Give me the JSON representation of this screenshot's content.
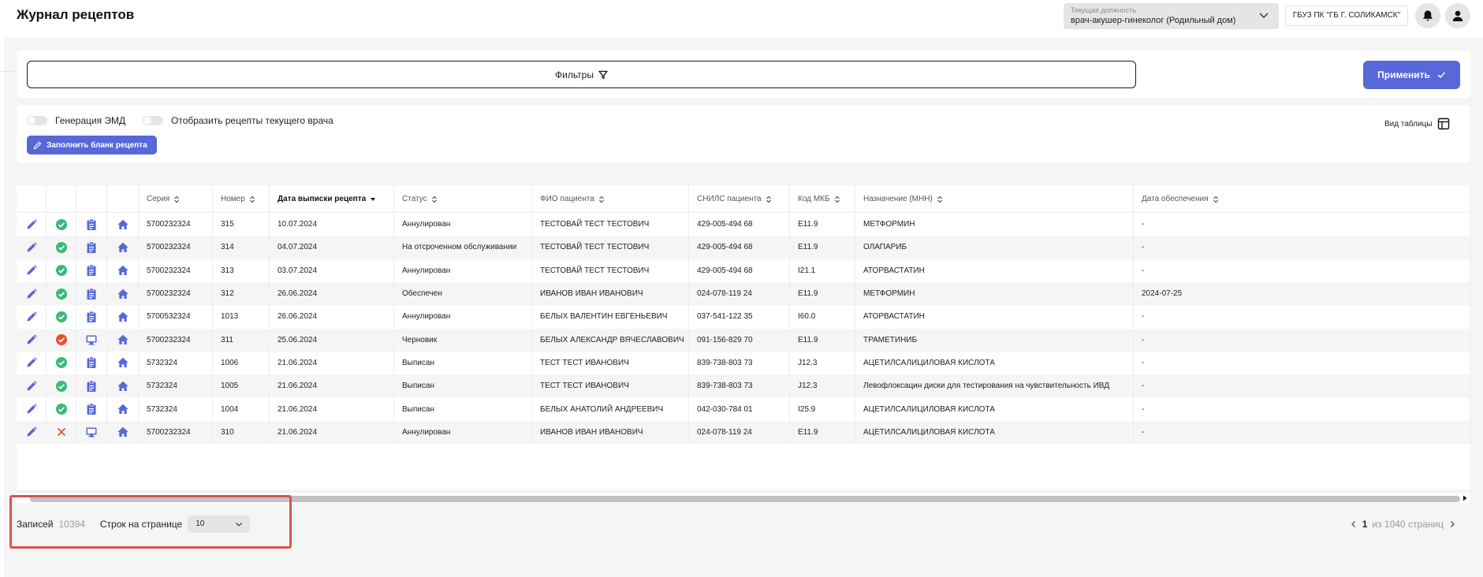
{
  "header": {
    "title": "Журнал рецептов",
    "role_caption": "Текущая должность",
    "role_value": "врач-акушер-гинеколог (Родильный дом)",
    "organization": "ГБУЗ ПК \"ГБ Г. СОЛИКАМСК\""
  },
  "filters": {
    "filters_label": "Фильтры",
    "apply_label": "Применить"
  },
  "options": {
    "toggle_emd": "Генерация ЭМД",
    "toggle_current_doctor": "Отобразить рецепты текущего врача",
    "fill_form_label": "Заполнить бланк рецепта",
    "table_view_label": "Вид таблицы"
  },
  "table": {
    "columns": [
      "Серия",
      "Номер",
      "Дата выписки рецепта",
      "Статус",
      "ФИО пациента",
      "СНИЛС пациента",
      "Код МКБ",
      "Назначение (МНН)",
      "Дата обеспечения"
    ],
    "rows": [
      {
        "status_icon": "check-circle-icon",
        "type_icon": "clipboard-icon",
        "series": "5700232324",
        "number": "315",
        "date": "10.07.2024",
        "status": "Аннулирован",
        "patient": "ТЕСТОВАЙ ТЕСТ ТЕСТОВИЧ",
        "snils": "429-005-494 68",
        "mkb": "E11.9",
        "mnn": "МЕТФОРМИН",
        "supply_date": "-"
      },
      {
        "status_icon": "check-circle-icon",
        "type_icon": "clipboard-icon",
        "series": "5700232324",
        "number": "314",
        "date": "04.07.2024",
        "status": "На отсроченном обслуживании",
        "patient": "ТЕСТОВАЙ ТЕСТ ТЕСТОВИЧ",
        "snils": "429-005-494 68",
        "mkb": "E11.9",
        "mnn": "ОЛАПАРИБ",
        "supply_date": "-"
      },
      {
        "status_icon": "check-circle-icon",
        "type_icon": "clipboard-icon",
        "series": "5700232324",
        "number": "313",
        "date": "03.07.2024",
        "status": "Аннулирован",
        "patient": "ТЕСТОВАЙ ТЕСТ ТЕСТОВИЧ",
        "snils": "429-005-494 68",
        "mkb": "I21.1",
        "mnn": "АТОРВАСТАТИН",
        "supply_date": "-"
      },
      {
        "status_icon": "check-circle-icon",
        "type_icon": "clipboard-icon",
        "series": "5700232324",
        "number": "312",
        "date": "26.06.2024",
        "status": "Обеспечен",
        "patient": "ИВАНОВ ИВАН ИВАНОВИЧ",
        "snils": "024-078-119 24",
        "mkb": "E11.9",
        "mnn": "МЕТФОРМИН",
        "supply_date": "2024-07-25"
      },
      {
        "status_icon": "check-circle-icon",
        "type_icon": "clipboard-icon",
        "series": "5700532324",
        "number": "1013",
        "date": "26.06.2024",
        "status": "Аннулирован",
        "patient": "БЕЛЫХ ВАЛЕНТИН ЕВГЕНЬЕВИЧ",
        "snils": "037-541-122 35",
        "mkb": "I60.0",
        "mnn": "АТОРВАСТАТИН",
        "supply_date": "-"
      },
      {
        "status_icon": "error-circle-icon",
        "type_icon": "monitor-icon",
        "series": "5700232324",
        "number": "311",
        "date": "25.06.2024",
        "status": "Черновик",
        "patient": "БЕЛЫХ АЛЕКСАНДР ВЯЧЕСЛАВОВИЧ",
        "snils": "091-156-829 70",
        "mkb": "E11.9",
        "mnn": "ТРАМЕТИНИБ",
        "supply_date": "-"
      },
      {
        "status_icon": "check-circle-icon",
        "type_icon": "clipboard-icon",
        "series": "5732324",
        "number": "1006",
        "date": "21.06.2024",
        "status": "Выписан",
        "patient": "ТЕСТ ТЕСТ ИВАНОВИЧ",
        "snils": "839-738-803 73",
        "mkb": "J12.3",
        "mnn": "АЦЕТИЛСАЛИЦИЛОВАЯ КИСЛОТА",
        "supply_date": "-"
      },
      {
        "status_icon": "check-circle-icon",
        "type_icon": "clipboard-icon",
        "series": "5732324",
        "number": "1005",
        "date": "21.06.2024",
        "status": "Выписан",
        "patient": "ТЕСТ ТЕСТ ИВАНОВИЧ",
        "snils": "839-738-803 73",
        "mkb": "J12.3",
        "mnn": "Левофлоксацин диски для тестирования на чувствительность ИВД",
        "supply_date": "-"
      },
      {
        "status_icon": "check-circle-icon",
        "type_icon": "clipboard-icon",
        "series": "5732324",
        "number": "1004",
        "date": "21.06.2024",
        "status": "Выписан",
        "patient": "БЕЛЫХ АНАТОЛИЙ АНДРЕЕВИЧ",
        "snils": "042-030-784 01",
        "mkb": "I25.9",
        "mnn": "АЦЕТИЛСАЛИЦИЛОВАЯ КИСЛОТА",
        "supply_date": "-"
      },
      {
        "status_icon": "x-icon",
        "type_icon": "monitor-icon",
        "series": "5700232324",
        "number": "310",
        "date": "21.06.2024",
        "status": "Аннулирован",
        "patient": "ИВАНОВ ИВАН ИВАНОВИЧ",
        "snils": "024-078-119 24",
        "mkb": "E11.9",
        "mnn": "АЦЕТИЛСАЛИЦИЛОВАЯ КИСЛОТА",
        "supply_date": "-"
      }
    ]
  },
  "pagination": {
    "records_label": "Записей",
    "records_count": "10394",
    "rows_per_page_label": "Строк на странице",
    "rows_per_page_value": "10",
    "current_page": "1",
    "of_pages": "из 1040 страниц"
  },
  "colors": {
    "accent": "#5868d8",
    "success": "#3cb878",
    "error": "#e5532b",
    "highlight": "#d9534f"
  }
}
